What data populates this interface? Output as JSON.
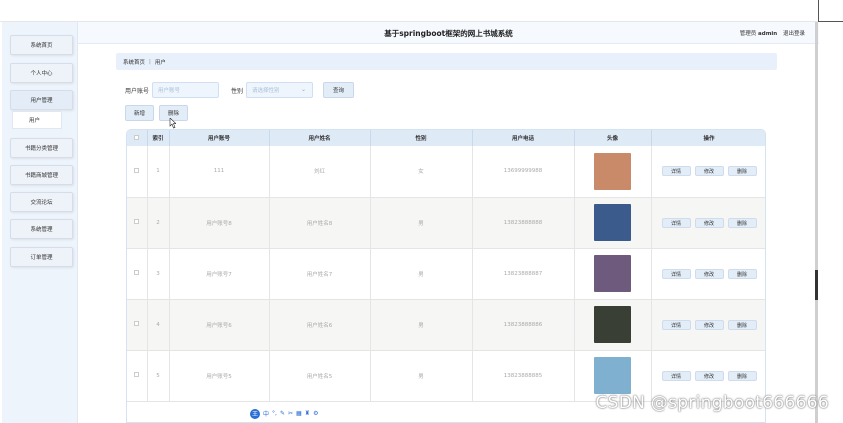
{
  "header": {
    "title": "基于springboot框架的网上书城系统",
    "user_prefix": "管理员",
    "user_name": "admin",
    "logout": "退出登录"
  },
  "sidebar": {
    "items": [
      {
        "label": "系统首页"
      },
      {
        "label": "个人中心"
      },
      {
        "label": "用户管理"
      },
      {
        "label": "书籍分类管理"
      },
      {
        "label": "书籍商城管理"
      },
      {
        "label": "交流论坛"
      },
      {
        "label": "系统管理"
      },
      {
        "label": "订单管理"
      }
    ],
    "sub_item": "用户"
  },
  "breadcrumb": {
    "home": "系统首页",
    "separator": "|",
    "current": "用户"
  },
  "search": {
    "account_label": "用户账号",
    "account_placeholder": "用户账号",
    "gender_label": "性别",
    "gender_placeholder": "请选择性别",
    "query_button": "查询"
  },
  "actions": {
    "add": "新增",
    "delete": "删除"
  },
  "table": {
    "headers": [
      "",
      "索引",
      "用户账号",
      "用户姓名",
      "性别",
      "用户电话",
      "头像",
      "操作"
    ],
    "rows": [
      {
        "index": "1",
        "account": "111",
        "name": "刘红",
        "gender": "女",
        "phone": "13699999988",
        "avatar_color": "#c98a6a"
      },
      {
        "index": "2",
        "account": "用户账号8",
        "name": "用户姓名8",
        "gender": "男",
        "phone": "13823888888",
        "avatar_color": "#3b5b8c"
      },
      {
        "index": "3",
        "account": "用户账号7",
        "name": "用户姓名7",
        "gender": "男",
        "phone": "13823888887",
        "avatar_color": "#6d5a7c"
      },
      {
        "index": "4",
        "account": "用户账号6",
        "name": "用户姓名6",
        "gender": "男",
        "phone": "13823888886",
        "avatar_color": "#3a3f36"
      },
      {
        "index": "5",
        "account": "用户账号5",
        "name": "用户姓名5",
        "gender": "男",
        "phone": "13823888885",
        "avatar_color": "#7fb0cf"
      }
    ],
    "op_labels": {
      "detail": "详情",
      "edit": "修改",
      "delete": "删除"
    }
  },
  "ime_toolbar": {
    "logo": "王",
    "items": [
      "中",
      "°,",
      "✎",
      "✂",
      "▦",
      "♜",
      "⚙"
    ]
  },
  "watermark": "CSDN @springboot666666"
}
